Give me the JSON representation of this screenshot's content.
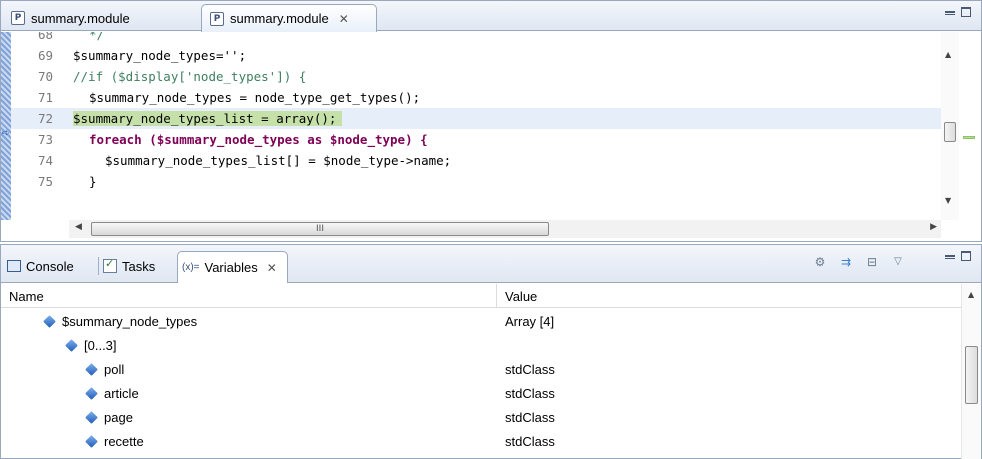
{
  "editor": {
    "tabs": [
      {
        "label": "summary.module",
        "icon": "php-file-icon",
        "active": false
      },
      {
        "label": "summary.module",
        "icon": "php-file-icon",
        "active": true,
        "close": "✕"
      }
    ],
    "lines": [
      {
        "num": "68",
        "text": "*/"
      },
      {
        "num": "69",
        "text": "$summary_node_types='';"
      },
      {
        "num": "70",
        "text": "//if ($display['node_types']) {"
      },
      {
        "num": "71",
        "text": "$summary_node_types = node_type_get_types();"
      },
      {
        "num": "72",
        "text": "$summary_node_types_list = array();"
      },
      {
        "num": "73",
        "text": "foreach ($summary_node_types as $node_type) {"
      },
      {
        "num": "74",
        "text": "$summary_node_types_list[] = $node_type->name;"
      },
      {
        "num": "75",
        "text": "}"
      }
    ],
    "hscroll_grip": "III"
  },
  "variables_view": {
    "tabs": {
      "console": "Console",
      "tasks": "Tasks",
      "variables": "Variables",
      "variables_prefix": "(x)=",
      "close": "✕"
    },
    "columns": {
      "name": "Name",
      "value": "Value"
    },
    "rows": [
      {
        "name": "$summary_node_types",
        "value": "Array [4]"
      },
      {
        "name": "[0...3]",
        "value": ""
      },
      {
        "name": "poll",
        "value": "stdClass"
      },
      {
        "name": "article",
        "value": "stdClass"
      },
      {
        "name": "page",
        "value": "stdClass"
      },
      {
        "name": "recette",
        "value": "stdClass"
      }
    ]
  },
  "colors": {
    "current_line_highlight": "#c5e0a8",
    "keyword": "#7f0055",
    "comment": "#3f7f5f",
    "string": "#2a00ff",
    "tab_border": "#99a8bd"
  }
}
